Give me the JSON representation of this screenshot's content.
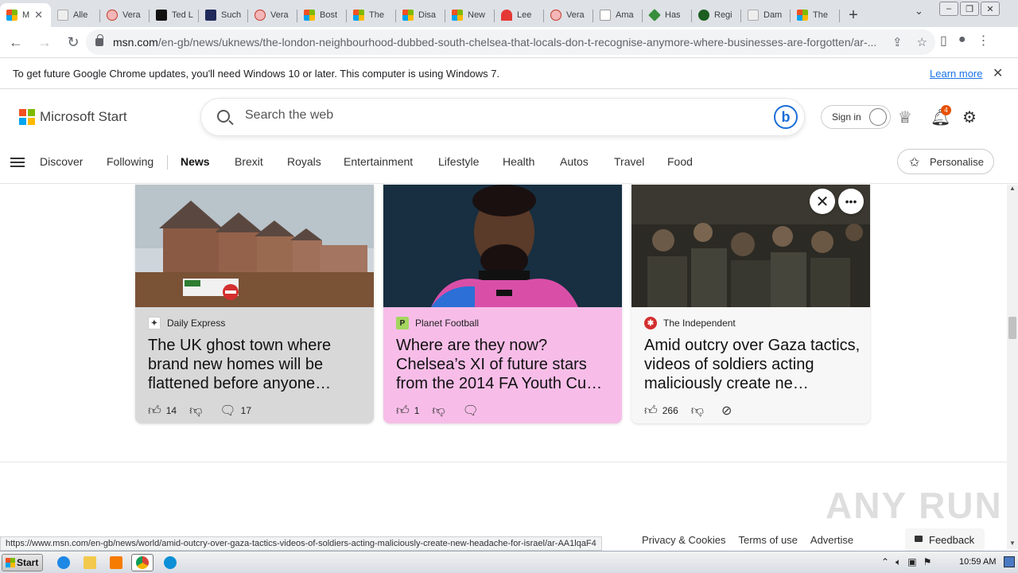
{
  "browser": {
    "tabs": [
      {
        "title": "M",
        "favicon": "msn-icon",
        "active": true
      },
      {
        "title": "Alle",
        "favicon": "tab-icon"
      },
      {
        "title": "Vera",
        "favicon": "circle-icon"
      },
      {
        "title": "Ted L",
        "favicon": "tv-icon"
      },
      {
        "title": "Such",
        "favicon": "mb-icon"
      },
      {
        "title": "Vera",
        "favicon": "circle-icon"
      },
      {
        "title": "Bost",
        "favicon": "msn-icon"
      },
      {
        "title": "The",
        "favicon": "msn-icon"
      },
      {
        "title": "Disa",
        "favicon": "msn-icon"
      },
      {
        "title": "New",
        "favicon": "msn-icon"
      },
      {
        "title": "Lee",
        "favicon": "red-icon"
      },
      {
        "title": "Vera",
        "favicon": "circle-icon"
      },
      {
        "title": "Ama",
        "favicon": "amazon-icon"
      },
      {
        "title": "Has",
        "favicon": "tag-icon"
      },
      {
        "title": "Regi",
        "favicon": "green-circle-icon"
      },
      {
        "title": "Dam",
        "favicon": "gray-icon"
      },
      {
        "title": "The",
        "favicon": "msn-icon"
      }
    ],
    "new_tab": "+",
    "url_host": "msn.com",
    "url_path": "/en-gb/news/uknews/the-london-neighbourhood-dubbed-south-chelsea-that-locals-don-t-recognise-anymore-where-businesses-are-forgotten/ar-...",
    "infobar": {
      "message": "To get future Google Chrome updates, you'll need Windows 10 or later. This computer is using Windows 7.",
      "learn_more": "Learn more"
    },
    "status_url": "https://www.msn.com/en-gb/news/world/amid-outcry-over-gaza-tactics-videos-of-soldiers-acting-maliciously-create-new-headache-for-israel/ar-AA1lqaF4"
  },
  "msn": {
    "brand": "Microsoft Start",
    "search_placeholder": "Search the web",
    "sign_in": "Sign in",
    "notification_count": "4",
    "nav": [
      "Discover",
      "Following",
      "News",
      "Brexit",
      "Royals",
      "Entertainment",
      "Lifestyle",
      "Health",
      "Autos",
      "Travel",
      "Food"
    ],
    "active_nav": "News",
    "personalise": "Personalise"
  },
  "cards": [
    {
      "source": "Daily Express",
      "headline": "The UK ghost town where brand new homes will be flattened before anyone…",
      "likes": "14",
      "comments": "17",
      "bg": "#d8d8d8"
    },
    {
      "source": "Planet Football",
      "headline": "Where are they now? Chelsea’s XI of future stars from the 2014 FA Youth Cu…",
      "likes": "1",
      "comments": "",
      "bg": "#f7bde8"
    },
    {
      "source": "The Independent",
      "headline": "Amid outcry over Gaza tactics, videos of soldiers acting maliciously create ne…",
      "likes": "266",
      "comments": "",
      "bg": "#f7f7f7"
    }
  ],
  "footer": {
    "links": [
      "Privacy & Cookies",
      "Terms of use",
      "Advertise"
    ],
    "feedback": "Feedback"
  },
  "watermark": "ANY RUN",
  "taskbar": {
    "start": "Start",
    "clock": "10:59 AM"
  }
}
